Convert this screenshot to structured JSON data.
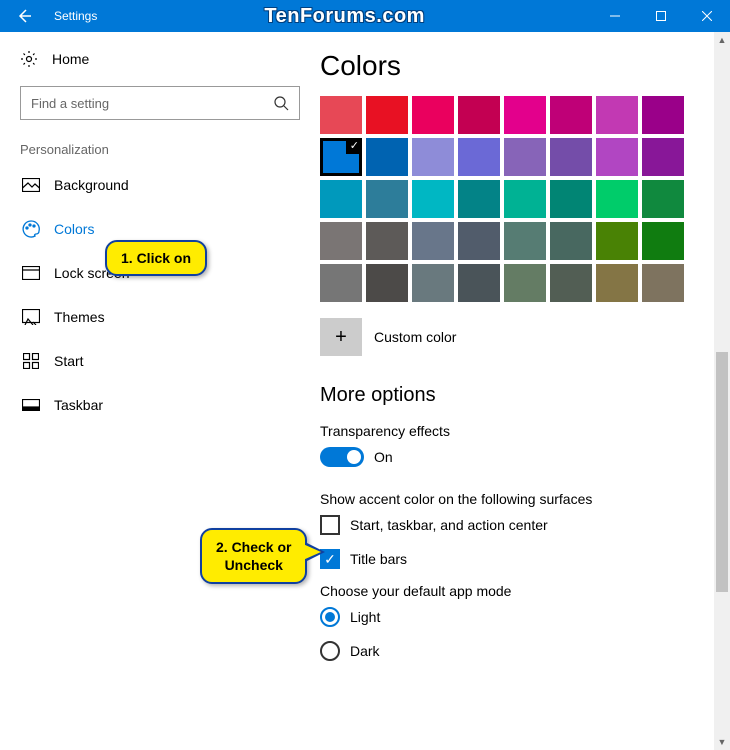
{
  "titlebar": {
    "title": "Settings",
    "watermark": "TenForums.com"
  },
  "sidebar": {
    "home": "Home",
    "search_placeholder": "Find a setting",
    "section": "Personalization",
    "items": [
      {
        "label": "Background"
      },
      {
        "label": "Colors"
      },
      {
        "label": "Lock screen"
      },
      {
        "label": "Themes"
      },
      {
        "label": "Start"
      },
      {
        "label": "Taskbar"
      }
    ]
  },
  "main": {
    "heading": "Colors",
    "palette": [
      "#e74856",
      "#e81123",
      "#ea005e",
      "#c30052",
      "#e3008c",
      "#bf0077",
      "#c239b3",
      "#9a0089",
      "#0078d7",
      "#0063b1",
      "#8e8cd8",
      "#6b69d6",
      "#8764b8",
      "#744da9",
      "#b146c2",
      "#881798",
      "#0099bc",
      "#2d7d9a",
      "#00b7c3",
      "#038387",
      "#00b294",
      "#018574",
      "#00cc6a",
      "#10893e",
      "#7a7574",
      "#5d5a58",
      "#68768a",
      "#515c6b",
      "#567c73",
      "#486860",
      "#498205",
      "#107c10",
      "#767676",
      "#4c4a48",
      "#69797e",
      "#4a5459",
      "#647c64",
      "#525e54",
      "#847545",
      "#7e735f"
    ],
    "selected_swatch_index": 8,
    "custom_color": "Custom color",
    "more_options": "More options",
    "transparency_label": "Transparency effects",
    "transparency_state": "On",
    "accent_label": "Show accent color on the following surfaces",
    "check_start": "Start, taskbar, and action center",
    "check_titlebars": "Title bars",
    "appmode_label": "Choose your default app mode",
    "radio_light": "Light",
    "radio_dark": "Dark"
  },
  "callouts": {
    "c1": "1. Click on",
    "c2a": "2. Check or",
    "c2b": "Uncheck"
  }
}
